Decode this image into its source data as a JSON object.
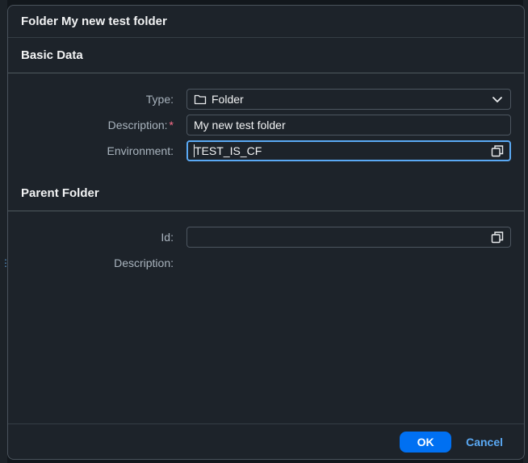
{
  "dialog": {
    "title": "Folder My new test folder"
  },
  "basic_data": {
    "title": "Basic Data",
    "type": {
      "label": "Type:",
      "value": "Folder",
      "icon": "folder-icon",
      "trailing_icon": "chevron-down-icon"
    },
    "description": {
      "label": "Description:",
      "required_mark": "*",
      "value": "My new test folder"
    },
    "environment": {
      "label": "Environment:",
      "value": "TEST_IS_CF",
      "trailing_icon": "value-help-icon"
    }
  },
  "parent_folder": {
    "title": "Parent Folder",
    "id": {
      "label": "Id:",
      "value": "",
      "trailing_icon": "value-help-icon"
    },
    "description": {
      "label": "Description:",
      "value": ""
    }
  },
  "footer": {
    "ok_label": "OK",
    "cancel_label": "Cancel"
  },
  "colors": {
    "accent": "#0070f2",
    "focus_border": "#5aa9f4",
    "required": "#ff6f8a",
    "dialog_bg": "#1d232a"
  }
}
